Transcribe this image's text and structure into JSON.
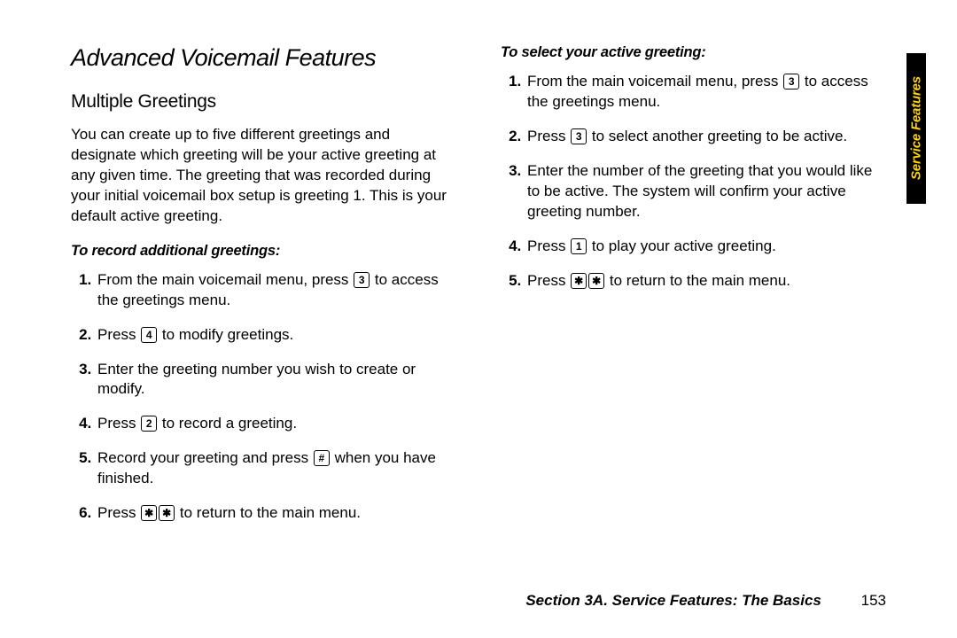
{
  "tab_label": "Service Features",
  "title": "Advanced Voicemail Features",
  "left": {
    "heading": "Multiple Greetings",
    "intro": "You can create up to five different greetings and designate which greeting will be your active greeting at any given time. The greeting that was recorded during your initial voicemail box setup is greeting 1. This is your default active greeting.",
    "subhead": "To record additional greetings:",
    "steps": {
      "s1a": "From the main voicemail menu, press ",
      "s1key": "3",
      "s1b": " to access the greetings menu.",
      "s2a": "Press ",
      "s2key": "4",
      "s2b": " to modify greetings.",
      "s3": "Enter the greeting number you wish to create or modify.",
      "s4a": "Press ",
      "s4key": "2",
      "s4b": " to record a greeting.",
      "s5a": "Record your greeting and press ",
      "s5key": "#",
      "s5b": " when you have finished.",
      "s6a": "Press ",
      "s6key1": "✱",
      "s6key2": "✱",
      "s6b": " to return to the main menu."
    }
  },
  "right": {
    "subhead": "To select your active greeting:",
    "steps": {
      "s1a": "From the main voicemail menu, press ",
      "s1key": "3",
      "s1b": " to access the greetings menu.",
      "s2a": "Press ",
      "s2key": "3",
      "s2b": " to select another greeting to be active.",
      "s3": "Enter the number of the greeting that you would like to be active. The system will confirm your active greeting number.",
      "s4a": "Press ",
      "s4key": "1",
      "s4b": " to play your active greeting.",
      "s5a": "Press ",
      "s5key1": "✱",
      "s5key2": "✱",
      "s5b": " to return to the main menu."
    }
  },
  "footer": {
    "section": "Section 3A. Service Features: The Basics",
    "page": "153"
  }
}
